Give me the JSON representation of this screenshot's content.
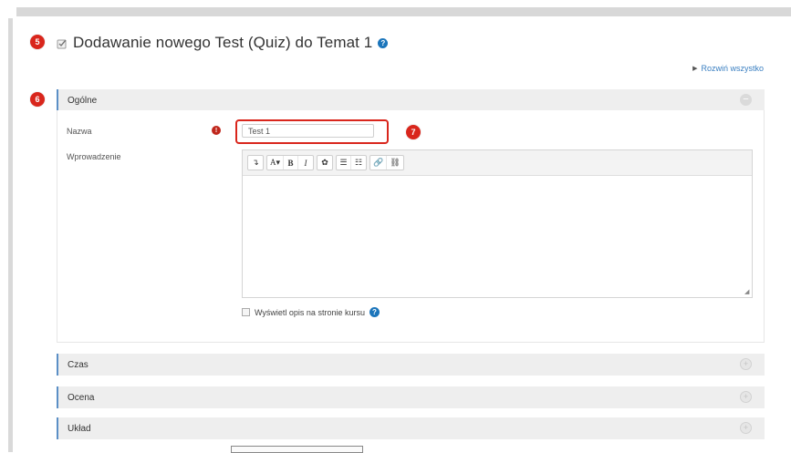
{
  "page": {
    "title": "Dodawanie nowego Test (Quiz) do Temat 1",
    "expand_all": "Rozwiń wszystko"
  },
  "markers": {
    "m5": "5",
    "m6": "6",
    "m7": "7"
  },
  "sections": {
    "general": {
      "label": "Ogólne",
      "state": "expanded"
    },
    "time": {
      "label": "Czas",
      "state": "collapsed"
    },
    "grade": {
      "label": "Ocena",
      "state": "collapsed"
    },
    "layout": {
      "label": "Układ",
      "state": "collapsed"
    }
  },
  "form": {
    "name_label": "Nazwa",
    "name_value": "Test 1",
    "intro_label": "Wprowadzenie",
    "show_description_label": "Wyświetl opis na stronie kursu"
  },
  "editor": {
    "toolbar": [
      [
        "↴"
      ],
      [
        "A▾",
        "B",
        "I"
      ],
      [
        "✿"
      ],
      [
        "☰",
        "☷"
      ],
      [
        "🔗",
        "⛓"
      ]
    ]
  },
  "colors": {
    "accent": "#5b8fc6",
    "marker": "#d9261c",
    "link": "#3a7fc1"
  }
}
